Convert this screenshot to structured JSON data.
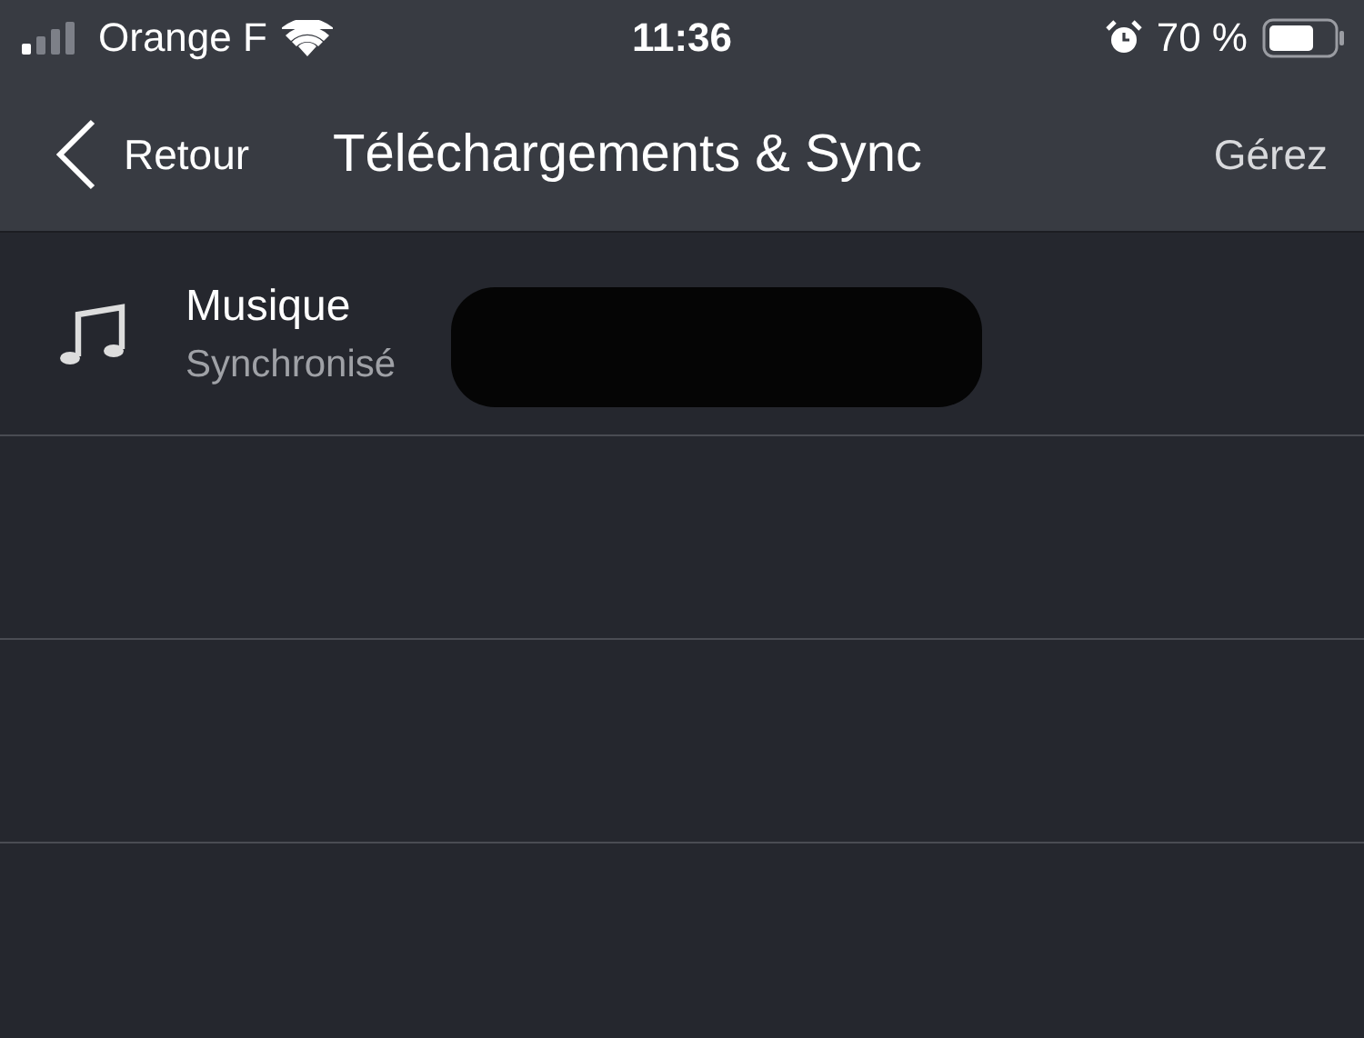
{
  "status_bar": {
    "carrier": "Orange F",
    "time": "11:36",
    "battery": "70 %"
  },
  "nav": {
    "back": "Retour",
    "title": "Téléchargements & Sync",
    "action": "Gérez"
  },
  "rows": [
    {
      "kind": "item",
      "title": "Musique",
      "subtitle": "Synchronisé",
      "redacted": true
    }
  ]
}
